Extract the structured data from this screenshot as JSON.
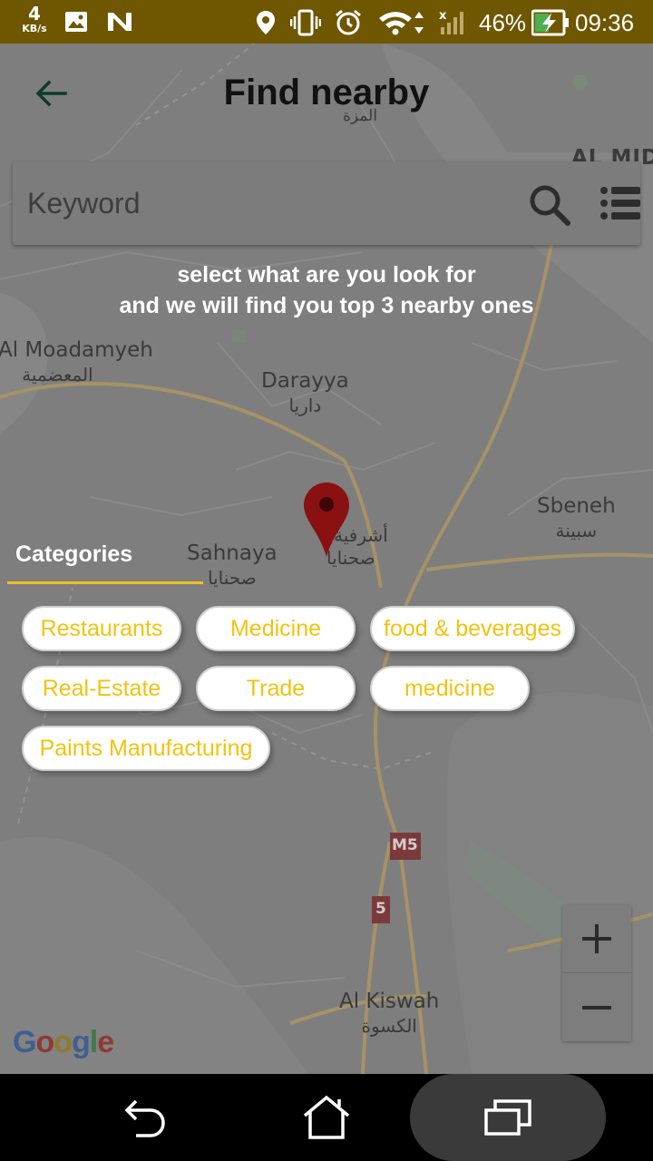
{
  "status_bar": {
    "net_speed": "4",
    "net_speed_unit": "KB/s",
    "battery": "46%",
    "time": "09:36"
  },
  "header": {
    "title": "Find nearby"
  },
  "search": {
    "placeholder": "Keyword",
    "value": ""
  },
  "instruction": {
    "line1": "select what are you look for",
    "line2": "and we will find you top 3 nearby ones"
  },
  "map": {
    "labels": {
      "mazzeh_ar": "المزة",
      "midan": "AL MID",
      "moadamyeh": "Al Moadamyeh",
      "moadamyeh_ar": "المعضمية",
      "darayya": "Darayya",
      "darayya_ar": "داريا",
      "sbeneh": "Sbeneh",
      "sbeneh_ar": "سبينة",
      "sahnaya": "Sahnaya",
      "sahnaya_ar": "صحنايا",
      "ashrafiyat_ar": "أشرفية",
      "sahnaya_ar2": "صحنايا",
      "kiswah": "Al Kiswah",
      "kiswah_ar": "الكسوة",
      "road_m5": "M5",
      "road_5": "5"
    },
    "attribution": "Google"
  },
  "categories": {
    "title": "Categories",
    "items": [
      "Restaurants",
      "Medicine",
      "food & beverages",
      "Real-Estate",
      "Trade",
      "medicine",
      "Paints Manufacturing"
    ]
  },
  "colors": {
    "accent": "#f2c30f",
    "status_bar": "#6f5600",
    "map_overlay": "#7e7e7e",
    "marker": "#8a1111"
  }
}
